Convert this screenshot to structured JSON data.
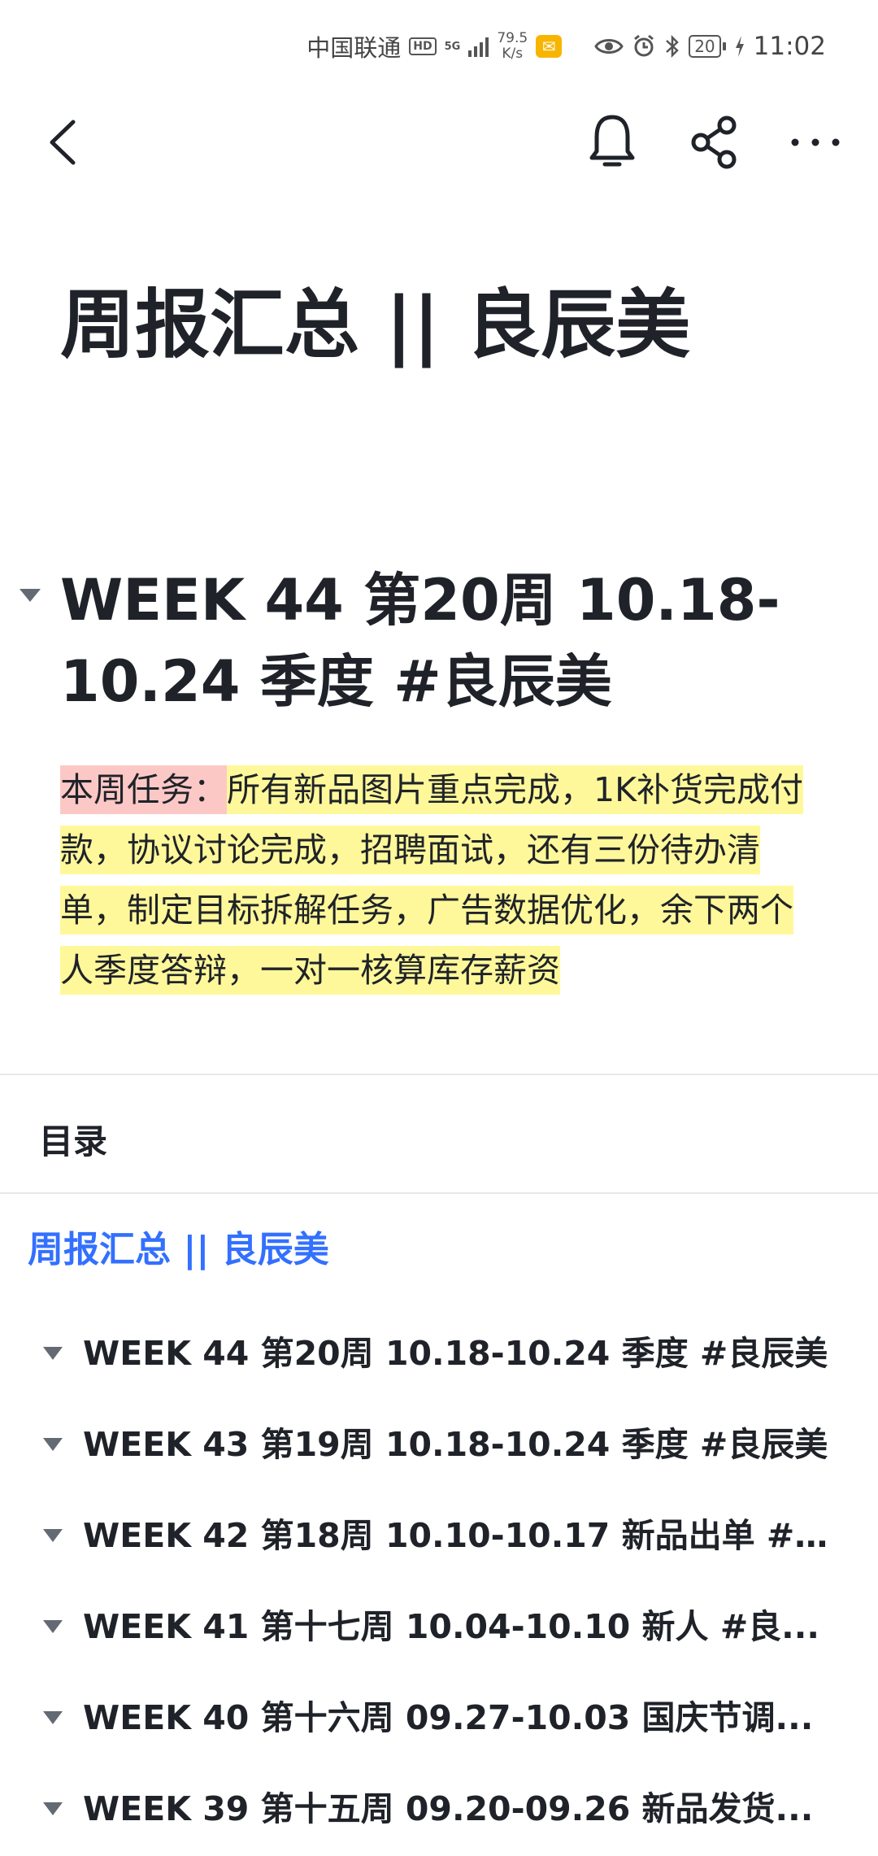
{
  "status_bar": {
    "carrier": "中国联通",
    "hd_badge": "HD",
    "network_type": "5G",
    "speed_value": "79.5",
    "speed_unit": "K/s",
    "battery_level": "20",
    "time": "11:02",
    "icons": [
      "hd-icon",
      "signal-icon",
      "mail-notification-icon",
      "eye-icon",
      "alarm-icon",
      "bluetooth-icon",
      "battery-icon",
      "charging-icon"
    ]
  },
  "nav": {
    "icons": [
      "back-icon",
      "bell-icon",
      "share-icon",
      "more-icon"
    ]
  },
  "document": {
    "title": "周报汇总 || 良辰美",
    "week_heading": "WEEK 44 第20周 10.18-10.24 季度 #良辰美",
    "task_label": "本周任务：",
    "task_body": "所有新品图片重点完成，1K补货完成付款，协议讨论完成，招聘面试，还有三份待办清单，制定目标拆解任务，广告数据优化，余下两个人季度答辩，一对一核算库存薪资"
  },
  "toc": {
    "header": "目录",
    "root": "周报汇总 || 良辰美",
    "items": [
      {
        "label": "WEEK 44 第20周 10.18-10.24 季度 #良辰美"
      },
      {
        "label": "WEEK 43 第19周 10.18-10.24 季度 #良辰美"
      },
      {
        "label": "WEEK 42 第18周 10.10-10.17 新品出单 #..."
      },
      {
        "label": "WEEK 41 第十七周 10.04-10.10 新人 #良..."
      },
      {
        "label": "WEEK 40 第十六周 09.27-10.03 国庆节调..."
      },
      {
        "label": "WEEK 39 第十五周 09.20-09.26 新品发货..."
      }
    ]
  },
  "colors": {
    "text": "#1f2329",
    "link": "#3370ff",
    "highlight_red": "#fcc8c6",
    "highlight_yellow": "#fff89a"
  }
}
